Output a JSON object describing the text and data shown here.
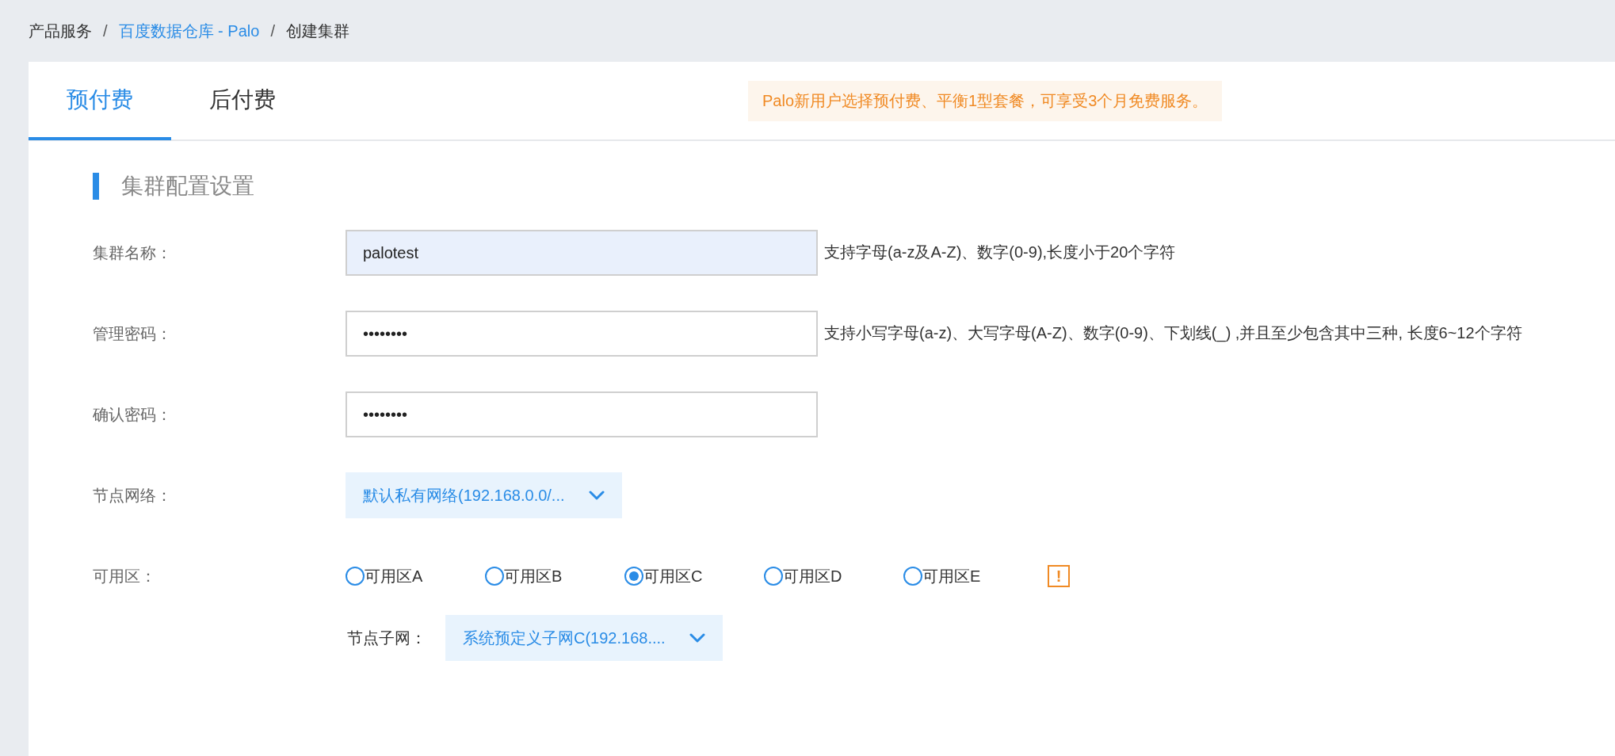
{
  "breadcrumb": [
    {
      "text": "产品服务",
      "link": false
    },
    {
      "text": "百度数据仓库 - Palo",
      "link": true
    },
    {
      "text": "创建集群",
      "link": false
    }
  ],
  "breadcrumb_separator": "/",
  "tabs": [
    {
      "label": "预付费",
      "selected": true
    },
    {
      "label": "后付费",
      "selected": false
    }
  ],
  "notice": "Palo新用户选择预付费、平衡1型套餐，可享受3个月免费服务。",
  "section_title": "集群配置设置",
  "fields": [
    {
      "kind": "input",
      "label": "集群名称：",
      "value": "palotest",
      "highlighted": true,
      "help": "支持字母(a-z及A-Z)、数字(0-9),长度小于20个字符"
    },
    {
      "kind": "input",
      "label": "管理密码：",
      "value": "••••••••",
      "highlighted": false,
      "help": "支持小写字母(a-z)、大写字母(A-Z)、数字(0-9)、下划线(_) ,并且至少包含其中三种, 长度6~12个字符"
    },
    {
      "kind": "input",
      "label": "确认密码：",
      "value": "••••••••",
      "highlighted": false
    },
    {
      "kind": "select",
      "label": "节点网络：",
      "value": "默认私有网络(192.168.0.0/..."
    },
    {
      "kind": "radio",
      "label": "可用区：",
      "options": [
        {
          "label": "可用区A",
          "selected": false
        },
        {
          "label": "可用区B",
          "selected": false
        },
        {
          "label": "可用区C",
          "selected": true
        },
        {
          "label": "可用区D",
          "selected": false
        },
        {
          "label": "可用区E",
          "selected": false
        }
      ],
      "alert": "!"
    },
    {
      "kind": "subselect",
      "label": "节点子网：",
      "value": "系统预定义子网C(192.168...."
    }
  ]
}
